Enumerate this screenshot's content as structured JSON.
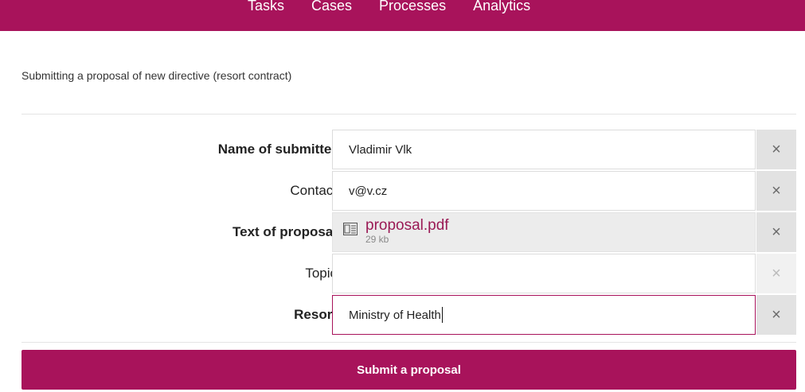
{
  "nav": {
    "items": [
      {
        "label": "Tasks"
      },
      {
        "label": "Cases"
      },
      {
        "label": "Processes"
      },
      {
        "label": "Analytics"
      }
    ]
  },
  "page": {
    "title": "Submitting a proposal of new directive (resort contract)"
  },
  "form": {
    "name_of_submitter": {
      "label": "Name of submitter",
      "value": "Vladimir Vlk",
      "clear": "×"
    },
    "contact": {
      "label": "Contact",
      "value": "v@v.cz",
      "clear": "×"
    },
    "text_of_proposal": {
      "label": "Text of proposal",
      "file_name": "proposal.pdf",
      "file_size": "29 kb",
      "icon": "pdf-file-icon",
      "clear": "×"
    },
    "topic": {
      "label": "Topic",
      "value": "",
      "clear": "×"
    },
    "resort": {
      "label": "Resort",
      "value": "Ministry of Health",
      "clear": "×"
    }
  },
  "submit": {
    "label": "Submit a proposal"
  },
  "colors": {
    "accent": "#a8135b",
    "link": "#9a1a55"
  }
}
